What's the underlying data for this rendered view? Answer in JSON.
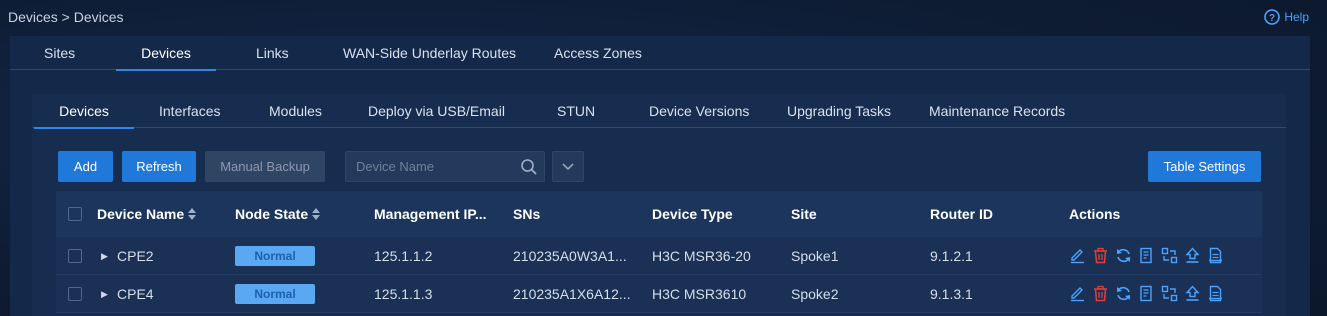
{
  "breadcrumb": "Devices > Devices",
  "help_label": "Help",
  "primary_tabs": [
    "Sites",
    "Devices",
    "Links",
    "WAN-Side Underlay Routes",
    "Access Zones"
  ],
  "secondary_tabs": [
    "Devices",
    "Interfaces",
    "Modules",
    "Deploy via USB/Email",
    "STUN",
    "Device Versions",
    "Upgrading Tasks",
    "Maintenance Records"
  ],
  "toolbar": {
    "add": "Add",
    "refresh": "Refresh",
    "manual_backup": "Manual Backup",
    "search_placeholder": "Device Name",
    "table_settings": "Table Settings"
  },
  "table": {
    "columns": [
      "Device Name",
      "Node State",
      "Management IP...",
      "SNs",
      "Device Type",
      "Site",
      "Router ID",
      "Actions"
    ],
    "rows": [
      {
        "name": "CPE2",
        "state": "Normal",
        "ip": "125.1.1.2",
        "sn": "210235A0W3A1...",
        "type": "H3C MSR36-20",
        "site": "Spoke1",
        "router_id": "9.1.2.1"
      },
      {
        "name": "CPE4",
        "state": "Normal",
        "ip": "125.1.1.3",
        "sn": "210235A1X6A12...",
        "type": "H3C MSR3610",
        "site": "Spoke2",
        "router_id": "9.1.3.1"
      }
    ]
  },
  "colors": {
    "accent": "#2078d8",
    "delete": "#e0403c",
    "badge": "#5aa8f2"
  }
}
